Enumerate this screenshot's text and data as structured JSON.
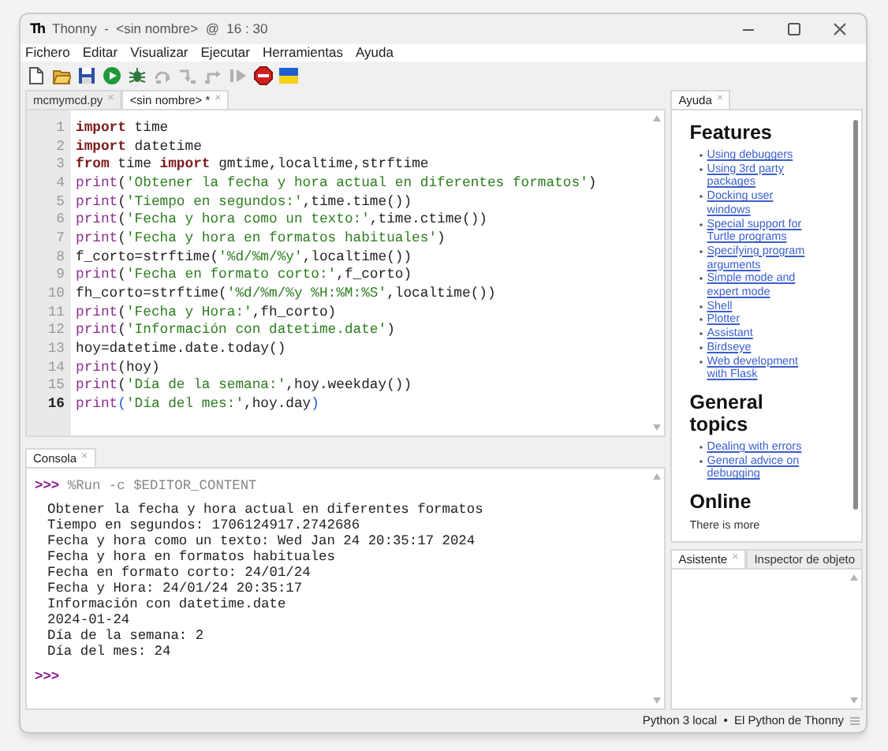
{
  "window": {
    "logo": "Th",
    "title": "Thonny  -  <sin nombre>  @  16 : 30"
  },
  "menu": [
    "Fichero",
    "Editar",
    "Visualizar",
    "Ejecutar",
    "Herramientas",
    "Ayuda"
  ],
  "toolbar": [
    {
      "kind": "new",
      "disabled": false
    },
    {
      "kind": "open",
      "disabled": false
    },
    {
      "kind": "save",
      "disabled": false
    },
    {
      "kind": "run",
      "disabled": false
    },
    {
      "kind": "debug",
      "disabled": false
    },
    {
      "kind": "step-over",
      "disabled": true
    },
    {
      "kind": "step-into",
      "disabled": true
    },
    {
      "kind": "step-out",
      "disabled": true
    },
    {
      "kind": "resume",
      "disabled": true
    },
    {
      "kind": "stop",
      "disabled": false
    },
    {
      "kind": "flag",
      "disabled": false
    }
  ],
  "editor_tabs": [
    {
      "label": "mcmymcd.py",
      "close": "×",
      "selected": false
    },
    {
      "label": "<sin nombre> *",
      "close": "×",
      "selected": true
    }
  ],
  "editor_lines": [
    {
      "number": "1",
      "current": false,
      "tokens": [
        {
          "kind": "keyword",
          "text": "import"
        },
        {
          "kind": "plain",
          "text": " time"
        }
      ]
    },
    {
      "number": "2",
      "current": false,
      "tokens": [
        {
          "kind": "keyword",
          "text": "import"
        },
        {
          "kind": "plain",
          "text": " datetime"
        }
      ]
    },
    {
      "number": "3",
      "current": false,
      "tokens": [
        {
          "kind": "keyword",
          "text": "from"
        },
        {
          "kind": "plain",
          "text": " time "
        },
        {
          "kind": "keyword",
          "text": "import"
        },
        {
          "kind": "plain",
          "text": " gmtime,localtime,strftime"
        }
      ]
    },
    {
      "number": "4",
      "current": false,
      "tokens": [
        {
          "kind": "builtin",
          "text": "print"
        },
        {
          "kind": "plain",
          "text": "("
        },
        {
          "kind": "string",
          "text": "'Obtener la fecha y hora actual en diferentes formatos'"
        },
        {
          "kind": "plain",
          "text": ")"
        }
      ]
    },
    {
      "number": "5",
      "current": false,
      "tokens": [
        {
          "kind": "builtin",
          "text": "print"
        },
        {
          "kind": "plain",
          "text": "("
        },
        {
          "kind": "string",
          "text": "'Tiempo en segundos:'"
        },
        {
          "kind": "plain",
          "text": ",time.time())"
        }
      ]
    },
    {
      "number": "6",
      "current": false,
      "tokens": [
        {
          "kind": "builtin",
          "text": "print"
        },
        {
          "kind": "plain",
          "text": "("
        },
        {
          "kind": "string",
          "text": "'Fecha y hora como un texto:'"
        },
        {
          "kind": "plain",
          "text": ",time.ctime())"
        }
      ]
    },
    {
      "number": "7",
      "current": false,
      "tokens": [
        {
          "kind": "builtin",
          "text": "print"
        },
        {
          "kind": "plain",
          "text": "("
        },
        {
          "kind": "string",
          "text": "'Fecha y hora en formatos habituales'"
        },
        {
          "kind": "plain",
          "text": ")"
        }
      ]
    },
    {
      "number": "8",
      "current": false,
      "tokens": [
        {
          "kind": "plain",
          "text": "f_corto=strftime("
        },
        {
          "kind": "string",
          "text": "'%d/%m/%y'"
        },
        {
          "kind": "plain",
          "text": ",localtime())"
        }
      ]
    },
    {
      "number": "9",
      "current": false,
      "tokens": [
        {
          "kind": "builtin",
          "text": "print"
        },
        {
          "kind": "plain",
          "text": "("
        },
        {
          "kind": "string",
          "text": "'Fecha en formato corto:'"
        },
        {
          "kind": "plain",
          "text": ",f_corto)"
        }
      ]
    },
    {
      "number": "10",
      "current": false,
      "tokens": [
        {
          "kind": "plain",
          "text": "fh_corto=strftime("
        },
        {
          "kind": "string",
          "text": "'%d/%m/%y %H:%M:%S'"
        },
        {
          "kind": "plain",
          "text": ",localtime())"
        }
      ]
    },
    {
      "number": "11",
      "current": false,
      "tokens": [
        {
          "kind": "builtin",
          "text": "print"
        },
        {
          "kind": "plain",
          "text": "("
        },
        {
          "kind": "string",
          "text": "'Fecha y Hora:'"
        },
        {
          "kind": "plain",
          "text": ",fh_corto)"
        }
      ]
    },
    {
      "number": "12",
      "current": false,
      "tokens": [
        {
          "kind": "builtin",
          "text": "print"
        },
        {
          "kind": "plain",
          "text": "("
        },
        {
          "kind": "string",
          "text": "'Información con datetime.date'"
        },
        {
          "kind": "plain",
          "text": ")"
        }
      ]
    },
    {
      "number": "13",
      "current": false,
      "tokens": [
        {
          "kind": "plain",
          "text": "hoy=datetime.date.today()"
        }
      ]
    },
    {
      "number": "14",
      "current": false,
      "tokens": [
        {
          "kind": "builtin",
          "text": "print"
        },
        {
          "kind": "plain",
          "text": "(hoy)"
        }
      ]
    },
    {
      "number": "15",
      "current": false,
      "tokens": [
        {
          "kind": "builtin",
          "text": "print"
        },
        {
          "kind": "plain",
          "text": "("
        },
        {
          "kind": "string",
          "text": "'Día de la semana:'"
        },
        {
          "kind": "plain",
          "text": ",hoy.weekday())"
        }
      ]
    },
    {
      "number": "16",
      "current": true,
      "tokens": [
        {
          "kind": "builtin",
          "text": "print"
        },
        {
          "kind": "bracket",
          "text": "("
        },
        {
          "kind": "string",
          "text": "'Día del mes:'"
        },
        {
          "kind": "plain",
          "text": ",hoy.day"
        },
        {
          "kind": "bracket",
          "text": ")"
        }
      ]
    }
  ],
  "console_tab": {
    "label": "Consola",
    "close": "×"
  },
  "console": {
    "prompt": ">>>",
    "command": "%Run -c $EDITOR_CONTENT",
    "output": [
      "Obtener la fecha y hora actual en diferentes formatos",
      "Tiempo en segundos: 1706124917.2742686",
      "Fecha y hora como un texto: Wed Jan 24 20:35:17 2024",
      "Fecha y hora en formatos habituales",
      "Fecha en formato corto: 24/01/24",
      "Fecha y Hora: 24/01/24 20:35:17",
      "Información con datetime.date",
      "2024-01-24",
      "Día de la semana: 2",
      "Día del mes: 24"
    ],
    "final_prompt": ">>>"
  },
  "help_tab": {
    "label": "Ayuda",
    "close": "×"
  },
  "help": [
    {
      "heading": "Features",
      "links": [
        "Using debuggers",
        "Using 3rd party packages",
        "Docking user windows",
        "Special support for Turtle programs",
        "Specifying program arguments",
        "Simple mode and expert mode",
        "Shell",
        "Plotter",
        "Assistant",
        "Birdseye",
        "Web development with Flask"
      ]
    },
    {
      "heading": "General topics",
      "links": [
        "Dealing with errors",
        "General advice on debugging"
      ]
    },
    {
      "heading": "Online",
      "text": "There is more"
    }
  ],
  "side_tabs": [
    {
      "label": "Asistente",
      "close": "×",
      "selected": true
    },
    {
      "label": "Inspector de objeto",
      "selected": false
    }
  ],
  "status_bar": {
    "interpreter": "Python 3 local  •  El Python de Thonny"
  }
}
